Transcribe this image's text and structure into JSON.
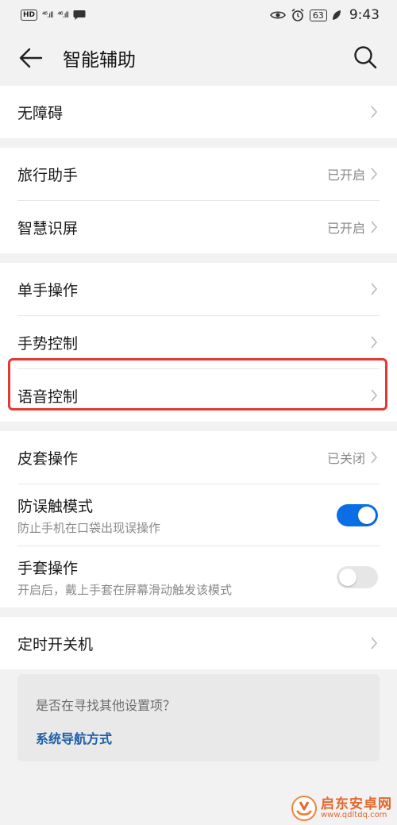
{
  "status_bar": {
    "left_hd": "HD",
    "left_signal_1": "⁴⁶.ıll",
    "left_signal_2": "⁴⁶.ıll",
    "battery": "63",
    "time": "9:43"
  },
  "header": {
    "title": "智能辅助"
  },
  "groups": {
    "g1": [
      {
        "label": "无障碍",
        "status": ""
      }
    ],
    "g2": [
      {
        "label": "旅行助手",
        "status": "已开启"
      },
      {
        "label": "智慧识屏",
        "status": "已开启"
      }
    ],
    "g3": [
      {
        "label": "单手操作",
        "status": ""
      },
      {
        "label": "手势控制",
        "status": ""
      },
      {
        "label": "语音控制",
        "status": ""
      }
    ],
    "g4": {
      "cover": {
        "label": "皮套操作",
        "status": "已关闭"
      },
      "anti_touch": {
        "label": "防误触模式",
        "sub": "防止手机在口袋出现误操作",
        "enabled": true
      },
      "glove": {
        "label": "手套操作",
        "sub": "开启后，戴上手套在屏幕滑动触发该模式",
        "enabled": false
      }
    },
    "g5": [
      {
        "label": "定时开关机",
        "status": ""
      }
    ]
  },
  "suggest": {
    "question": "是否在寻找其他设置项？",
    "link": "系统导航方式"
  },
  "watermark": {
    "name": "启东安卓网",
    "url": "www.qdltdq.com"
  },
  "colors": {
    "accent": "#0a6fe6",
    "highlight": "#e53935",
    "link": "#1e5fa8"
  }
}
